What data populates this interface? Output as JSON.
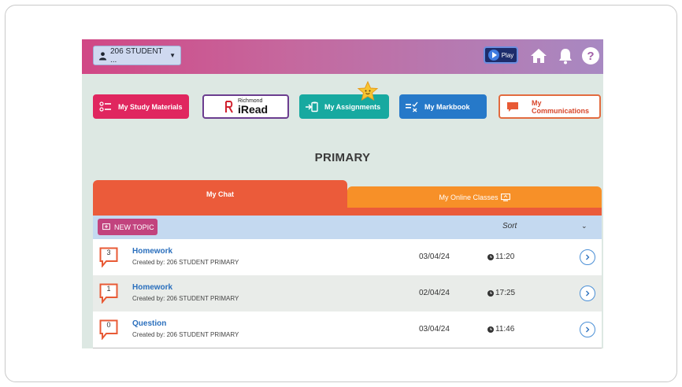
{
  "header": {
    "student_label": "206 STUDENT ...",
    "play_label": "Play"
  },
  "nav": {
    "study_materials": "My Study Materials",
    "iread_brand": "Richmond",
    "iread_name": "iRead",
    "assignments": "My Assignments",
    "markbook": "My Markbook",
    "communications": "My Communications"
  },
  "page_title": "PRIMARY",
  "tabs": {
    "chat": "My Chat",
    "online_classes": "My Online Classes"
  },
  "list": {
    "new_topic": "NEW TOPIC",
    "sort": "Sort",
    "rows": [
      {
        "count": "3",
        "title": "Homework",
        "created_by": "Created by: 206 STUDENT PRIMARY",
        "date": "03/04/24",
        "time": "11:20"
      },
      {
        "count": "1",
        "title": "Homework",
        "created_by": "Created by: 206 STUDENT PRIMARY",
        "date": "02/04/24",
        "time": "17:25"
      },
      {
        "count": "0",
        "title": "Question",
        "created_by": "Created by: 206 STUDENT PRIMARY",
        "date": "03/04/24",
        "time": "11:46"
      }
    ]
  },
  "colors": {
    "study": "#e0265f",
    "assignments": "#17a9a0",
    "markbook": "#2679c9",
    "chat_tab": "#eb5b3a",
    "online_tab": "#f79028",
    "link": "#2a6fbd"
  },
  "icons": [
    "user-icon",
    "play-icon",
    "home-icon",
    "bell-icon",
    "help-icon",
    "list-icon",
    "assignment-icon",
    "markbook-icon",
    "chat-bubble-icon",
    "star-icon",
    "screen-icon",
    "new-topic-icon",
    "clock-icon",
    "chevron-right-icon",
    "chevron-down-icon"
  ]
}
